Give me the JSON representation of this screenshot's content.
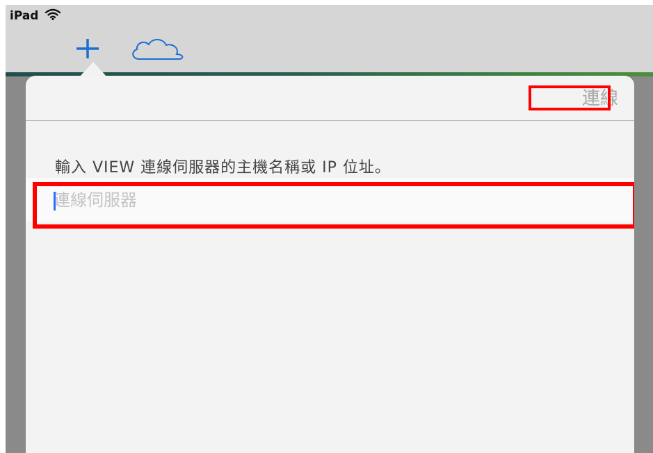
{
  "status_bar": {
    "device": "iPad",
    "wifi_icon": "wifi-icon"
  },
  "toolbar": {
    "add_icon": "plus-icon",
    "cloud_icon": "cloud-icon",
    "accent": "#2a5e52"
  },
  "popover": {
    "connect_label": "連線",
    "instruction": "輸入 VIEW 連線伺服器的主機名稱或 IP 位址。",
    "server_field": {
      "value": "",
      "placeholder": "連線伺服器"
    }
  },
  "highlights": {
    "color": "#ff0000"
  }
}
